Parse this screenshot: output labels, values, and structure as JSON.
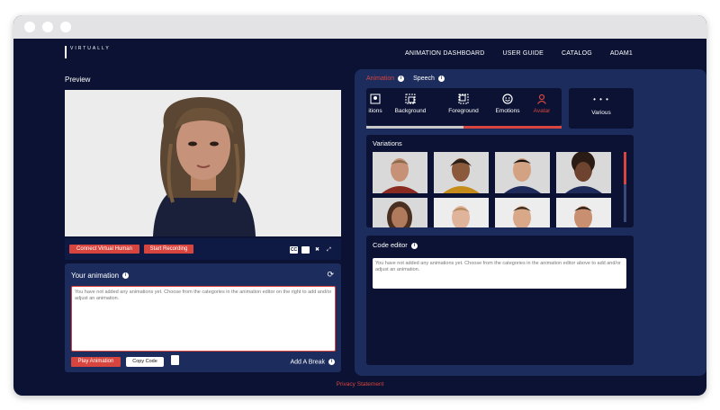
{
  "nav": {
    "logo_text": "VIRTUALLY",
    "links": [
      "ANIMATION DASHBOARD",
      "USER GUIDE",
      "CATALOG",
      "ADAM1"
    ]
  },
  "preview": {
    "title": "Preview",
    "connect_label": "Connect Virtual Human",
    "record_label": "Start Recording",
    "cc_label": "CC"
  },
  "animation": {
    "title": "Your animation",
    "placeholder": "You have not added any animations yet. Choose from the categories in the animation editor on the right to add and/or adjust an animation.",
    "play_label": "Play Animation",
    "copy_label": "Copy Code",
    "add_break_label": "Add A Break"
  },
  "editor": {
    "tabs": [
      {
        "label": "Animation",
        "active": true
      },
      {
        "label": "Speech",
        "active": false
      }
    ],
    "categories": [
      "itions",
      "Background",
      "Foreground",
      "Emotions",
      "Avatar"
    ],
    "active_category": "Avatar",
    "various_label": "Various",
    "various_dots": "• • •",
    "variations_title": "Variations",
    "code_editor_title": "Code editor",
    "code_placeholder": "You have not added any animations yet. Choose from the categories in the animation editor above to add and/or adjust an animation."
  },
  "footer": {
    "privacy": "Privacy Statement"
  },
  "colors": {
    "background": "#0b1233",
    "panel": "#1c2c5c",
    "accent": "#d8453f"
  }
}
